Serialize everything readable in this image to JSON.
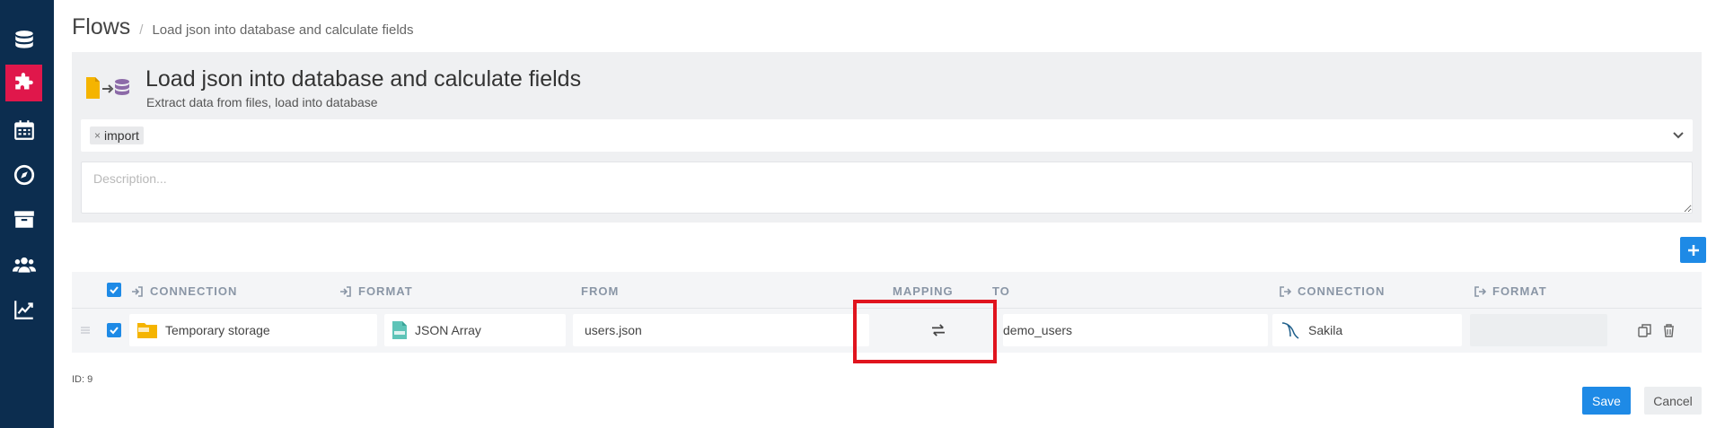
{
  "breadcrumb": {
    "title": "Flows",
    "separator": "/",
    "current": "Load json into database and calculate fields"
  },
  "flow": {
    "title": "Load json into database and calculate fields",
    "subtitle": "Extract data from files, load into database",
    "tags": [
      "import"
    ],
    "description_placeholder": "Description..."
  },
  "table": {
    "headers": {
      "source_connection": "CONNECTION",
      "source_format": "FORMAT",
      "from": "FROM",
      "mapping": "MAPPING",
      "to": "TO",
      "target_connection": "CONNECTION",
      "target_format": "FORMAT"
    },
    "rows": [
      {
        "source_connection": "Temporary storage",
        "source_format": "JSON Array",
        "from": "users.json",
        "to": "demo_users",
        "target_connection": "Sakila",
        "target_format": ""
      }
    ]
  },
  "footer": {
    "id_label": "ID: 9",
    "save_label": "Save",
    "cancel_label": "Cancel"
  },
  "colors": {
    "sidebar_bg": "#0c2d4f",
    "sidebar_active": "#e0174b",
    "primary": "#1e8ae6",
    "highlight": "#e0141e"
  }
}
